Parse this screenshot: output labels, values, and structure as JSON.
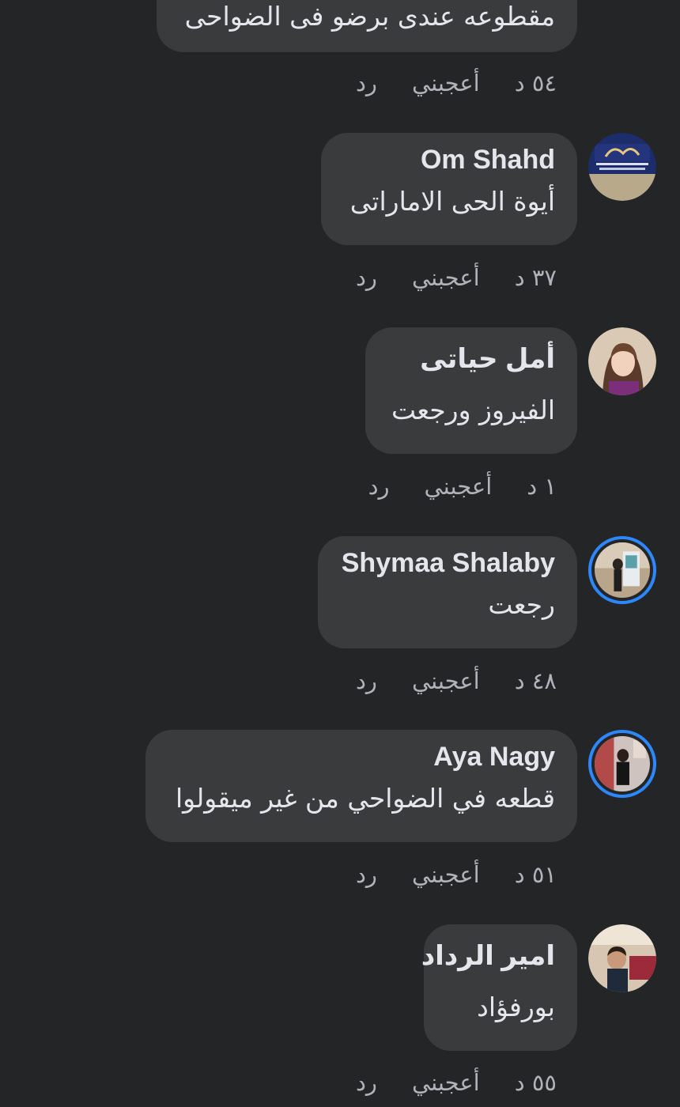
{
  "actions": {
    "like": "أعجبني",
    "reply": "رد"
  },
  "comments": [
    {
      "author": "",
      "text": "مقطوعه عندى برضو فى الضواحى",
      "time": "٥٤ د"
    },
    {
      "author": "Om Shahd",
      "text": "أيوة الحى الاماراتى",
      "time": "٣٧ د"
    },
    {
      "author": "أمل حياتى",
      "text": "الفيروز ورجعت",
      "time": "١ د"
    },
    {
      "author": "Shymaa Shalaby",
      "text": "رجعت",
      "time": "٤٨ د"
    },
    {
      "author": "Aya Nagy",
      "text": "قطعه في الضواحي من غير ميقولوا",
      "time": "٥١ د"
    },
    {
      "author": "امير الرداد",
      "text": "بورفؤاد",
      "time": "٥٥ د"
    }
  ],
  "colors": {
    "background": "#242527",
    "bubble": "#3a3b3c",
    "text_primary": "#e4e6eb",
    "text_secondary": "#b0b3b8",
    "story_ring": "#2d88ff"
  }
}
